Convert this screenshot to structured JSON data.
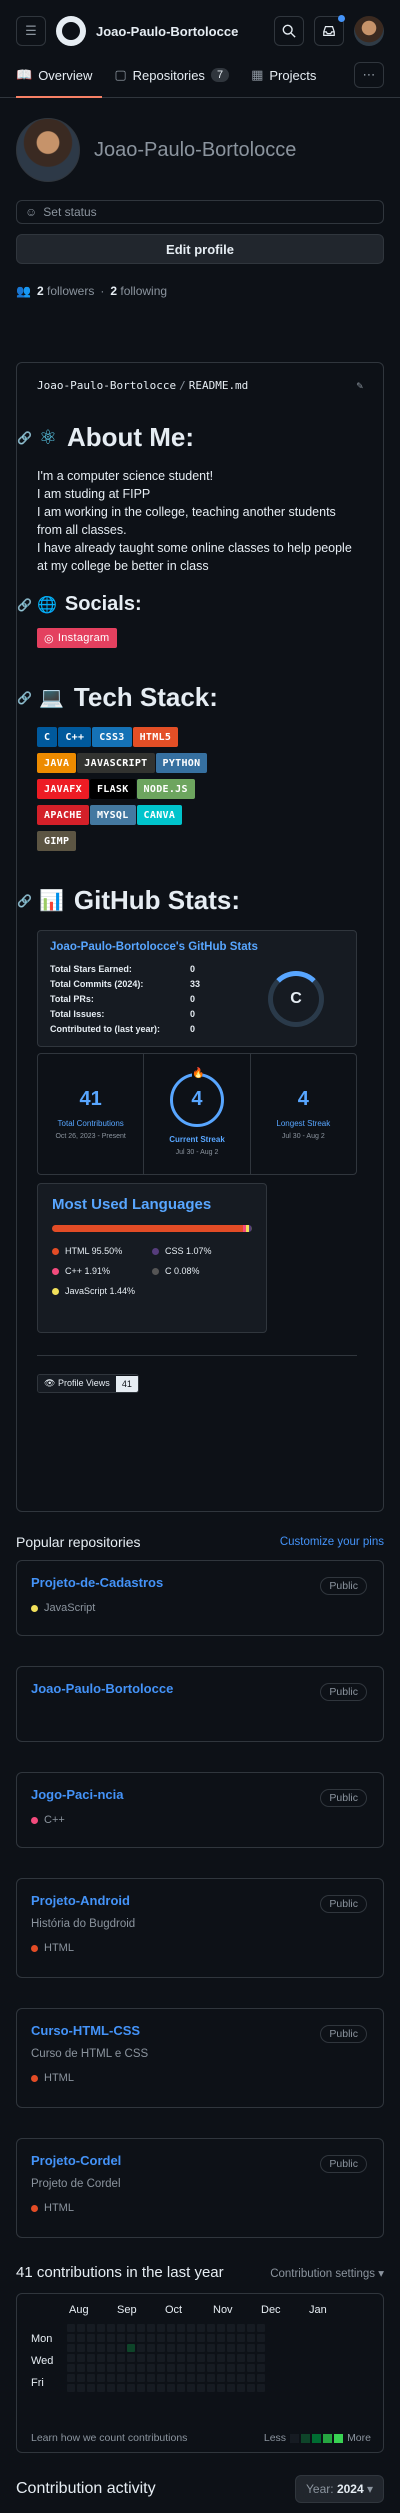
{
  "header": {
    "username": "Joao-Paulo-Bortolocce",
    "menu_icon": "hamburger-icon",
    "search_icon": "search-icon",
    "inbox_icon": "inbox-icon"
  },
  "tabs": [
    {
      "label": "Overview",
      "icon": "book-icon"
    },
    {
      "label": "Repositories",
      "icon": "repo-icon",
      "count": "7"
    },
    {
      "label": "Projects",
      "icon": "table-icon"
    }
  ],
  "profile": {
    "display_name": "Joao-Paulo-Bortolocce",
    "status_label": "Set status",
    "edit_label": "Edit profile",
    "followers_count": "2",
    "followers_label": "followers",
    "following_count": "2",
    "following_label": "following"
  },
  "readme": {
    "owner": "Joao-Paulo-Bortolocce",
    "file": "README.md",
    "about_title": "About Me:",
    "about_lines": [
      "I'm a computer science student!",
      "I am studing at FIPP",
      "I am working in the college, teaching another students from all classes.",
      "I have already taught some online classes to help people at my college be better in class"
    ],
    "socials_title": "Socials:",
    "instagram_label": "Instagram",
    "tech_title": "Tech Stack:",
    "tech": [
      {
        "label": "C",
        "color": "#00599C"
      },
      {
        "label": "C++",
        "color": "#00599C"
      },
      {
        "label": "CSS3",
        "color": "#1572B6"
      },
      {
        "label": "HTML5",
        "color": "#E34F26"
      },
      {
        "label": "JAVA",
        "color": "#ED8B00"
      },
      {
        "label": "JAVASCRIPT",
        "color": "#323330"
      },
      {
        "label": "PYTHON",
        "color": "#3670A0"
      },
      {
        "label": "JAVAFX",
        "color": "#ED1C24"
      },
      {
        "label": "FLASK",
        "color": "#000000"
      },
      {
        "label": "NODE.JS",
        "color": "#6DA55F"
      },
      {
        "label": "APACHE",
        "color": "#D42029"
      },
      {
        "label": "MYSQL",
        "color": "#4479A1"
      },
      {
        "label": "CANVA",
        "color": "#00C4CC"
      },
      {
        "label": "GIMP",
        "color": "#5C5543"
      }
    ],
    "stats_title": "GitHub Stats:",
    "stats_card": {
      "title": "Joao-Paulo-Bortolocce's GitHub Stats",
      "rows": [
        {
          "k": "Total Stars Earned:",
          "v": "0"
        },
        {
          "k": "Total Commits (2024):",
          "v": "33"
        },
        {
          "k": "Total PRs:",
          "v": "0"
        },
        {
          "k": "Total Issues:",
          "v": "0"
        },
        {
          "k": "Contributed to (last year):",
          "v": "0"
        }
      ],
      "rank": "C"
    },
    "streak": {
      "total": "41",
      "total_label": "Total Contributions",
      "total_range": "Oct 26, 2023 - Present",
      "current": "4",
      "current_label": "Current Streak",
      "current_range": "Jul 30 - Aug 2",
      "longest": "4",
      "longest_label": "Longest Streak",
      "longest_range": "Jul 30 - Aug 2"
    },
    "langs": {
      "title": "Most Used Languages",
      "items": [
        {
          "name": "HTML 95.50%",
          "color": "#e34c26"
        },
        {
          "name": "CSS 1.07%",
          "color": "#563d7c"
        },
        {
          "name": "C++ 1.91%",
          "color": "#f34b7d"
        },
        {
          "name": "C 0.08%",
          "color": "#555555"
        },
        {
          "name": "JavaScript 1.44%",
          "color": "#f1e05a"
        }
      ]
    },
    "profile_views_label": "Profile Views",
    "profile_views": "41"
  },
  "popular": {
    "title": "Popular repositories",
    "customize": "Customize your pins",
    "public_label": "Public",
    "repos": [
      {
        "name": "Projeto-de-Cadastros",
        "desc": "",
        "lang": "JavaScript",
        "color": "#f1e05a"
      },
      {
        "name": "Joao-Paulo-Bortolocce",
        "desc": "",
        "lang": "",
        "color": ""
      },
      {
        "name": "Jogo-Paci-ncia",
        "desc": "",
        "lang": "C++",
        "color": "#f34b7d"
      },
      {
        "name": "Projeto-Android",
        "desc": "História do Bugdroid",
        "lang": "HTML",
        "color": "#e34c26"
      },
      {
        "name": "Curso-HTML-CSS",
        "desc": "Curso de HTML e CSS",
        "lang": "HTML",
        "color": "#e34c26"
      },
      {
        "name": "Projeto-Cordel",
        "desc": "Projeto de Cordel",
        "lang": "HTML",
        "color": "#e34c26"
      }
    ]
  },
  "contrib": {
    "title": "41 contributions in the last year",
    "settings": "Contribution settings",
    "months": [
      "Aug",
      "Sep",
      "Oct",
      "Nov",
      "Dec",
      "Jan"
    ],
    "days": [
      "Mon",
      "Wed",
      "Fri"
    ],
    "learn": "Learn how we count contributions",
    "less": "Less",
    "more": "More"
  },
  "activity": {
    "title": "Contribution activity",
    "year_label": "Year:",
    "year": "2024"
  }
}
